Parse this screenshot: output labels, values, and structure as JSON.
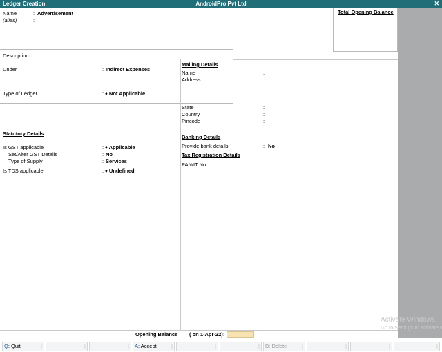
{
  "window": {
    "screen_title": "Ledger Creation",
    "company": "AndroidPro Pvt Ltd",
    "close_glyph": "✕"
  },
  "ledger": {
    "name_label": "Name",
    "name_value": "Advertisement",
    "alias_label": "(alias)",
    "description_label": "Description",
    "under_label": "Under",
    "under_value": "Indirect Expenses",
    "type_label": "Type of Ledger",
    "type_value": "Not Applicable"
  },
  "total_opening_balance": {
    "title": "Total Opening Balance"
  },
  "statutory": {
    "title": "Statutory Details",
    "gst_label": "Is GST applicable",
    "gst_value": "Applicable",
    "set_alter_label": "Set/Alter GST Details",
    "set_alter_value": "No",
    "supply_label": "Type of Supply",
    "supply_value": "Services",
    "tds_label": "Is TDS applicable",
    "tds_value": "Undefined"
  },
  "mailing": {
    "title": "Mailing Details",
    "name_label": "Name",
    "address_label": "Address",
    "state_label": "State",
    "country_label": "Country",
    "pincode_label": "Pincode"
  },
  "banking": {
    "title": "Banking Details",
    "provide_label": "Provide bank details",
    "provide_value": "No"
  },
  "tax_registration": {
    "title": "Tax Registration Details",
    "pan_label": "PAN/IT No."
  },
  "opening_balance": {
    "label": "Opening Balance",
    "date_note": "( on 1-Apr-22)",
    "cursor": "."
  },
  "footer": {
    "quit_key": "Q",
    "quit_label": ": Quit",
    "accept_key": "A",
    "accept_label": ": Accept",
    "delete_key": "D",
    "delete_label": ": Delete"
  },
  "watermark": {
    "line1": "Activate Windows",
    "line2": "Go to Settings to activate Windows."
  },
  "colors": {
    "titlebar": "#1f6e78",
    "right_panel": "#a9abad",
    "input_bg": "#f7e3b2"
  }
}
